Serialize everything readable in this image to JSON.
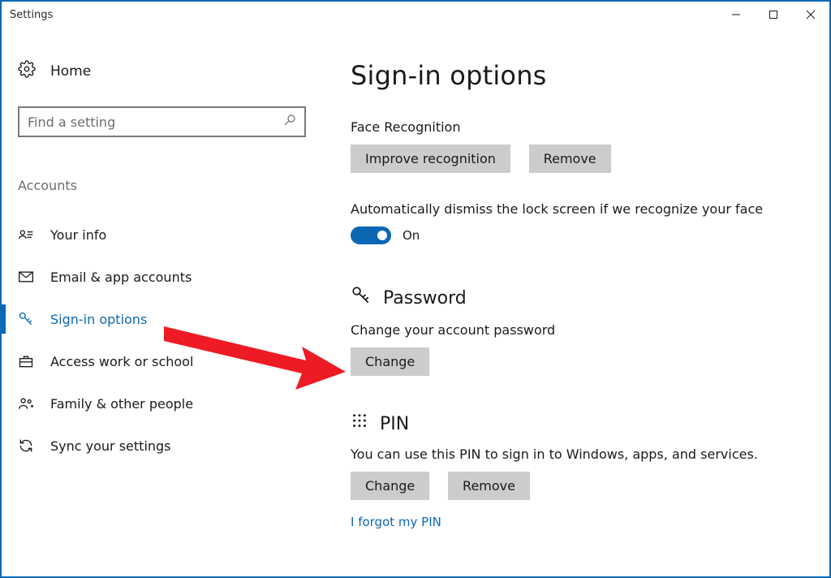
{
  "window": {
    "title": "Settings"
  },
  "sidebar": {
    "home": "Home",
    "search_placeholder": "Find a setting",
    "category": "Accounts",
    "items": [
      {
        "label": "Your info"
      },
      {
        "label": "Email & app accounts"
      },
      {
        "label": "Sign-in options"
      },
      {
        "label": "Access work or school"
      },
      {
        "label": "Family & other people"
      },
      {
        "label": "Sync your settings"
      }
    ]
  },
  "main": {
    "title": "Sign-in options",
    "face": {
      "label": "Face Recognition",
      "improve": "Improve recognition",
      "remove": "Remove",
      "auto_dismiss": "Automatically dismiss the lock screen if we recognize your face",
      "toggle_state": "On"
    },
    "password": {
      "heading": "Password",
      "desc": "Change your account password",
      "change": "Change"
    },
    "pin": {
      "heading": "PIN",
      "desc": "You can use this PIN to sign in to Windows, apps, and services.",
      "change": "Change",
      "remove": "Remove",
      "forgot": "I forgot my PIN"
    }
  },
  "colors": {
    "accent": "#0a68b5"
  }
}
